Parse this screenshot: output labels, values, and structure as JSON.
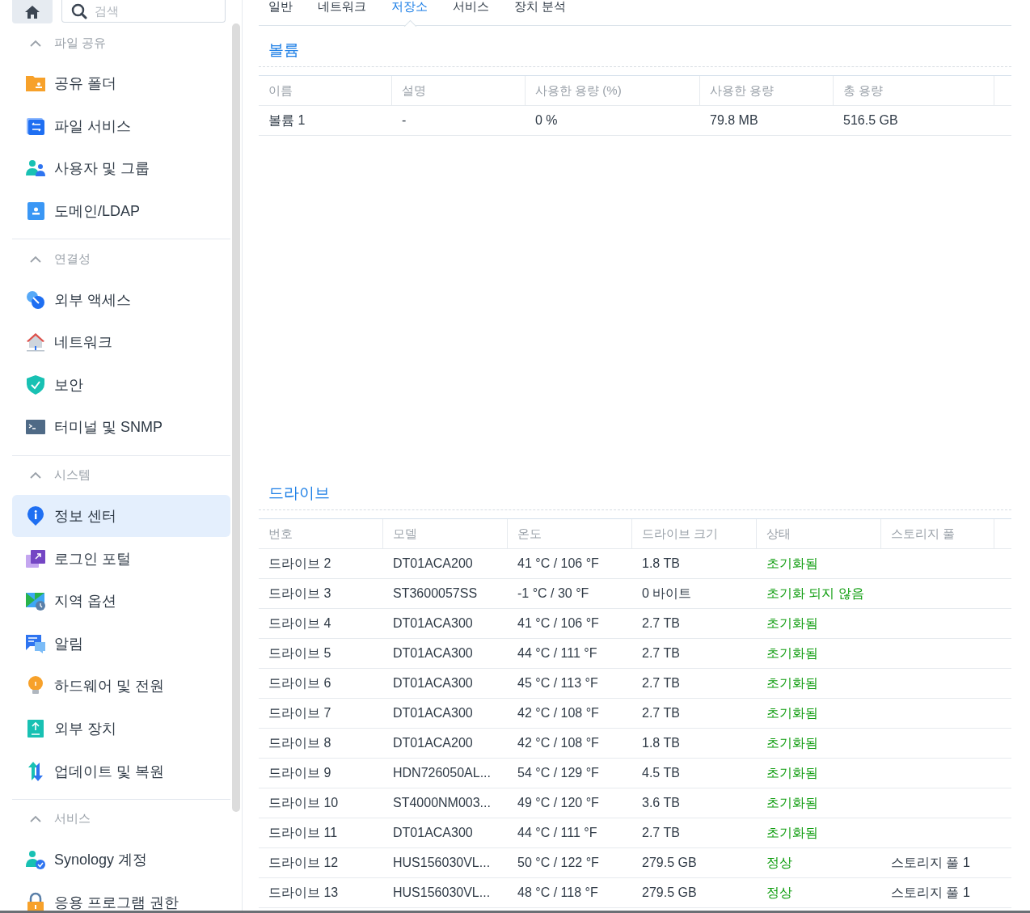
{
  "sidebar": {
    "search": {
      "placeholder": "검색"
    },
    "groups": [
      {
        "title": "파일 공유",
        "expanded": true,
        "items": [
          {
            "label": "공유 폴더",
            "selected": false
          },
          {
            "label": "파일 서비스",
            "selected": false
          },
          {
            "label": "사용자 및 그룹",
            "selected": false
          },
          {
            "label": "도메인/LDAP",
            "selected": false
          }
        ]
      },
      {
        "title": "연결성",
        "expanded": true,
        "items": [
          {
            "label": "외부 액세스",
            "selected": false
          },
          {
            "label": "네트워크",
            "selected": false
          },
          {
            "label": "보안",
            "selected": false
          },
          {
            "label": "터미널 및 SNMP",
            "selected": false
          }
        ]
      },
      {
        "title": "시스템",
        "expanded": true,
        "items": [
          {
            "label": "정보 센터",
            "selected": true
          },
          {
            "label": "로그인 포털",
            "selected": false
          },
          {
            "label": "지역 옵션",
            "selected": false
          },
          {
            "label": "알림",
            "selected": false
          },
          {
            "label": "하드웨어 및 전원",
            "selected": false
          },
          {
            "label": "외부 장치",
            "selected": false
          },
          {
            "label": "업데이트 및 복원",
            "selected": false
          }
        ]
      },
      {
        "title": "서비스",
        "expanded": true,
        "items": [
          {
            "label": "Synology 계정",
            "selected": false
          },
          {
            "label": "응용 프로그램 권한",
            "selected": false
          }
        ]
      }
    ]
  },
  "tabs": [
    {
      "label": "일반",
      "selected": false
    },
    {
      "label": "네트워크",
      "selected": false
    },
    {
      "label": "저장소",
      "selected": true
    },
    {
      "label": "서비스",
      "selected": false
    },
    {
      "label": "장치 분석",
      "selected": false
    }
  ],
  "volumes": {
    "title": "볼륨",
    "columns": [
      "이름",
      "설명",
      "사용한 용량 (%)",
      "사용한 용량",
      "총 용량"
    ],
    "rows": [
      [
        "볼륨 1",
        "-",
        "0 %",
        "79.8 MB",
        "516.5 GB"
      ]
    ]
  },
  "drives": {
    "title": "드라이브",
    "columns": [
      "번호",
      "모델",
      "온도",
      "드라이브 크기",
      "상태",
      "스토리지 풀"
    ],
    "rows": [
      [
        "드라이브 2",
        "DT01ACA200",
        "41 °C / 106 °F",
        "1.8 TB",
        "초기화됨",
        ""
      ],
      [
        "드라이브 3",
        "ST3600057SS",
        "-1 °C / 30 °F",
        "0 바이트",
        "초기화 되지 않음",
        ""
      ],
      [
        "드라이브 4",
        "DT01ACA300",
        "41 °C / 106 °F",
        "2.7 TB",
        "초기화됨",
        ""
      ],
      [
        "드라이브 5",
        "DT01ACA300",
        "44 °C / 111 °F",
        "2.7 TB",
        "초기화됨",
        ""
      ],
      [
        "드라이브 6",
        "DT01ACA300",
        "45 °C / 113 °F",
        "2.7 TB",
        "초기화됨",
        ""
      ],
      [
        "드라이브 7",
        "DT01ACA300",
        "42 °C / 108 °F",
        "2.7 TB",
        "초기화됨",
        ""
      ],
      [
        "드라이브 8",
        "DT01ACA200",
        "42 °C / 108 °F",
        "1.8 TB",
        "초기화됨",
        ""
      ],
      [
        "드라이브 9",
        "HDN726050AL...",
        "54 °C / 129 °F",
        "4.5 TB",
        "초기화됨",
        ""
      ],
      [
        "드라이브 10",
        "ST4000NM003...",
        "49 °C / 120 °F",
        "3.6 TB",
        "초기화됨",
        ""
      ],
      [
        "드라이브 11",
        "DT01ACA300",
        "44 °C / 111 °F",
        "2.7 TB",
        "초기화됨",
        ""
      ],
      [
        "드라이브 12",
        "HUS156030VL...",
        "50 °C / 122 °F",
        "279.5 GB",
        "정상",
        "스토리지 풀 1"
      ],
      [
        "드라이브 13",
        "HUS156030VL...",
        "48 °C / 118 °F",
        "279.5 GB",
        "정상",
        "스토리지 풀 1"
      ]
    ]
  }
}
